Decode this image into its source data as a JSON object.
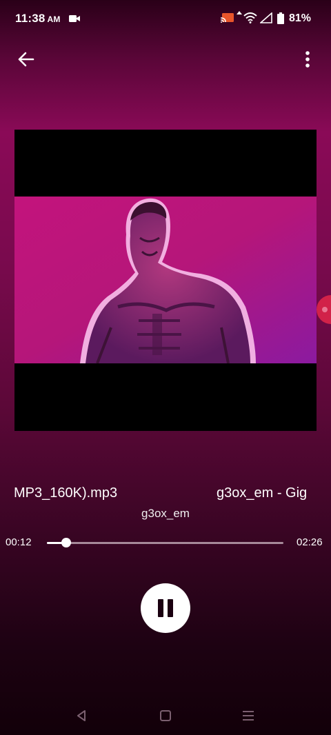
{
  "status": {
    "time": "11:38",
    "ampm": "AM",
    "battery": "81%"
  },
  "player": {
    "title_a": "MP3_160K).mp3",
    "title_b": "g3ox_em - Gig",
    "artist": "g3ox_em",
    "elapsed": "00:12",
    "total": "02:26",
    "progress": 0.082
  },
  "icons": [
    "video-cam-icon",
    "cast-icon",
    "wifi-icon",
    "signal-icon",
    "battery-icon",
    "back-arrow-icon",
    "more-vert-icon",
    "pause-icon",
    "nav-back-icon",
    "nav-home-icon",
    "nav-recents-icon"
  ]
}
